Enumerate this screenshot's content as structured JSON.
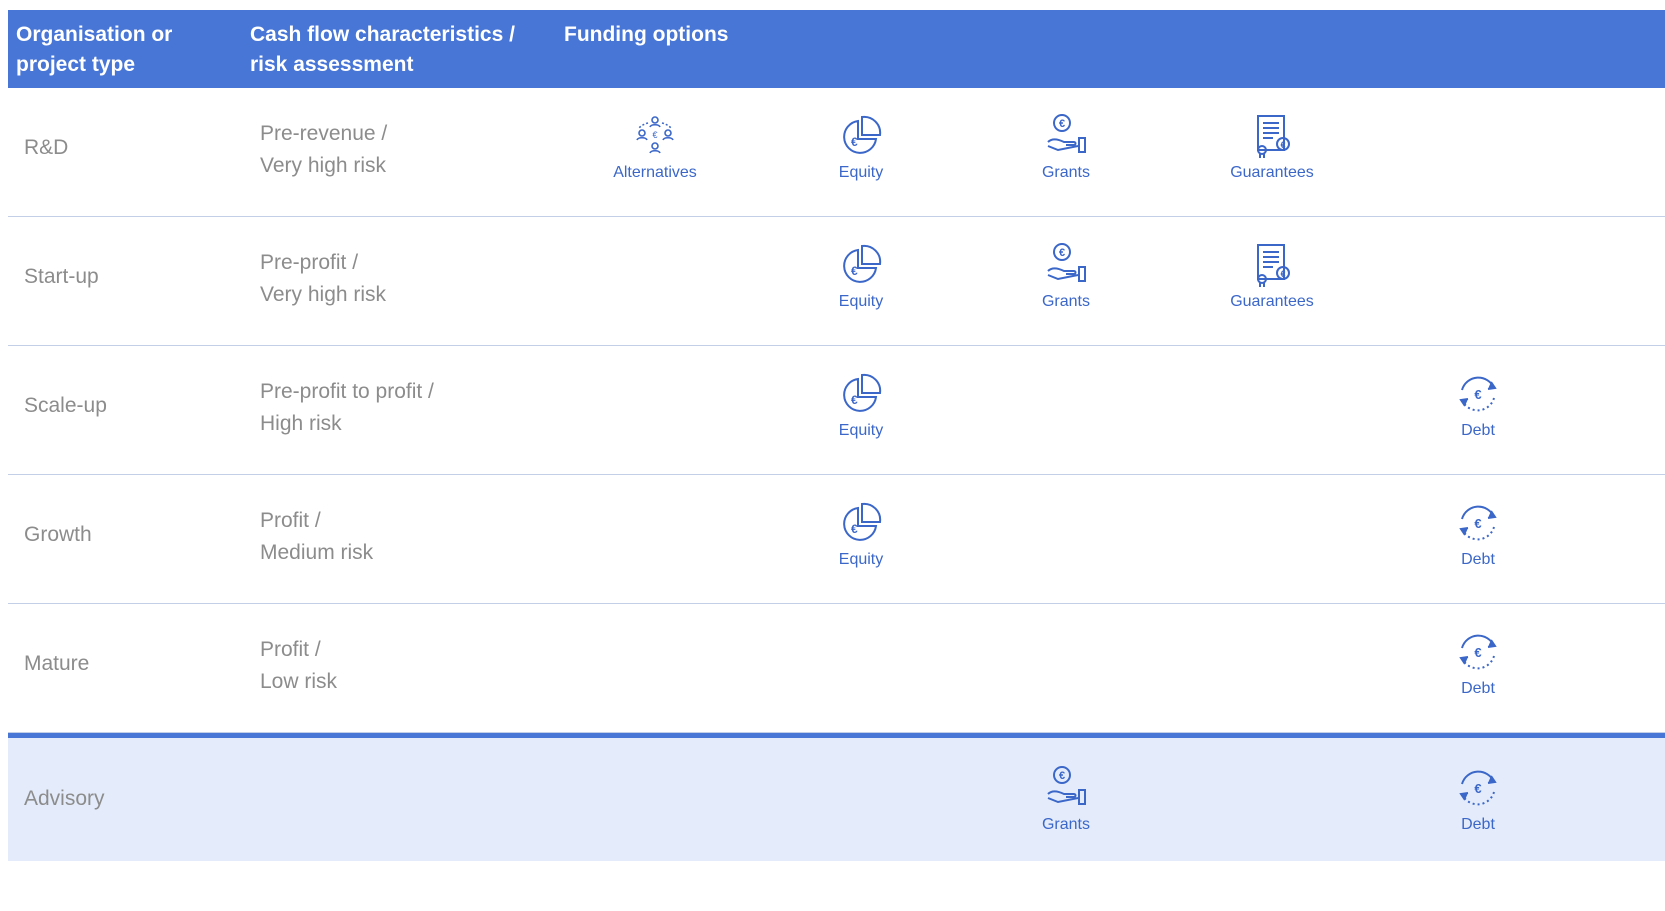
{
  "header": {
    "col1": "Organisation or\nproject type",
    "col2": "Cash flow characteristics /\nrisk assessment",
    "col3": "Funding options"
  },
  "accent_color": "#4876d6",
  "icons": {
    "alternatives": "people-network-icon",
    "equity": "euro-pie-chart-icon",
    "grants": "euro-hand-icon",
    "guarantees": "certificate-document-icon",
    "debt": "euro-cycle-icon"
  },
  "options": {
    "alternatives": "Alternatives",
    "equity": "Equity",
    "grants": "Grants",
    "guarantees": "Guarantees",
    "debt": "Debt"
  },
  "rows": [
    {
      "type": "R&D",
      "risk1": "Pre-revenue /",
      "risk2": "Very high risk",
      "options": [
        "alternatives",
        "equity",
        "grants",
        "guarantees"
      ]
    },
    {
      "type": "Start-up",
      "risk1": "Pre-profit /",
      "risk2": "Very high risk",
      "options": [
        "equity",
        "grants",
        "guarantees"
      ]
    },
    {
      "type": "Scale-up",
      "risk1": "Pre-profit to profit /",
      "risk2": "High risk",
      "options": [
        "equity",
        "debt"
      ]
    },
    {
      "type": "Growth",
      "risk1": "Profit /",
      "risk2": "Medium risk",
      "options": [
        "equity",
        "debt"
      ]
    },
    {
      "type": "Mature",
      "risk1": "Profit /",
      "risk2": "Low risk",
      "options": [
        "debt"
      ]
    },
    {
      "type": "Advisory",
      "risk1": "",
      "risk2": "",
      "options": [
        "grants",
        "debt"
      ]
    }
  ]
}
